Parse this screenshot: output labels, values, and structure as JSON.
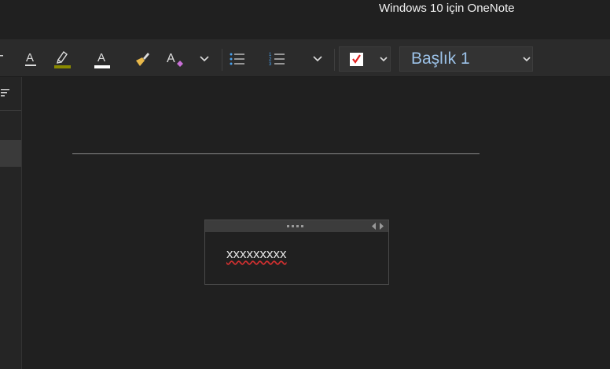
{
  "window": {
    "title": "Windows 10 için OneNote"
  },
  "ribbon": {
    "font_color_glyph": "A",
    "clear_format_glyph": "A",
    "style_dropdown": {
      "value": "Başlık 1"
    }
  },
  "colors": {
    "highlight": "#8a8a00",
    "todo_check": "#e02020",
    "list_accent": "#4aa3f0",
    "heading_text": "#9cc2e8",
    "spell_error": "#d23030"
  },
  "icons": [
    "font-color-icon",
    "highlight-icon",
    "font-color-white-icon",
    "format-painter-icon",
    "clear-formatting-icon",
    "chevron-down-icon",
    "bullet-list-icon",
    "numbered-list-icon",
    "todo-tag-icon",
    "sort-icon",
    "move-arrows-icon"
  ],
  "note": {
    "text": "xxxxxxxxx"
  }
}
